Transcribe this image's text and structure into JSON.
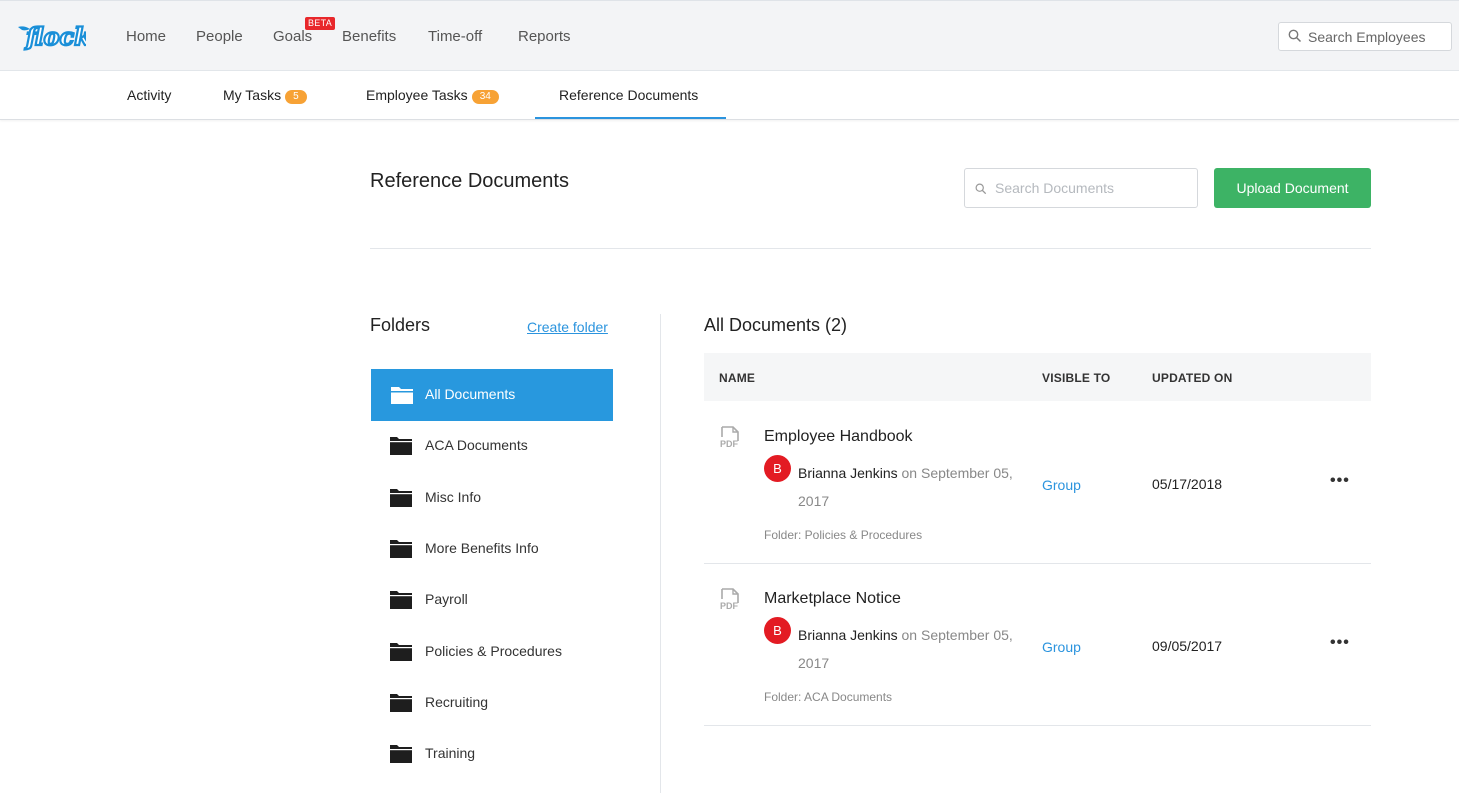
{
  "app": {
    "logo_text": "flock"
  },
  "nav": {
    "items": [
      {
        "label": "Home"
      },
      {
        "label": "People"
      },
      {
        "label": "Goals"
      },
      {
        "label": "Benefits"
      },
      {
        "label": "Time-off"
      },
      {
        "label": "Reports"
      }
    ],
    "goals_badge": "BETA",
    "search_placeholder": "Search Employees"
  },
  "tabs": [
    {
      "label": "Activity",
      "count": null
    },
    {
      "label": "My Tasks",
      "count": "5"
    },
    {
      "label": "Employee Tasks",
      "count": "34"
    },
    {
      "label": "Reference Documents",
      "count": null,
      "active": true
    }
  ],
  "page": {
    "title": "Reference Documents",
    "search_placeholder": "Search Documents",
    "upload_label": "Upload Document"
  },
  "folders": {
    "title": "Folders",
    "create_label": "Create folder",
    "items": [
      {
        "label": "All Documents",
        "active": true
      },
      {
        "label": "ACA Documents"
      },
      {
        "label": "Misc Info"
      },
      {
        "label": "More Benefits Info"
      },
      {
        "label": "Payroll"
      },
      {
        "label": "Policies & Procedures"
      },
      {
        "label": "Recruiting"
      },
      {
        "label": "Training"
      }
    ]
  },
  "documents": {
    "title": "All Documents (2)",
    "columns": {
      "name": "NAME",
      "visible_to": "VISIBLE TO",
      "updated_on": "UPDATED ON"
    },
    "rows": [
      {
        "file_type": "PDF",
        "name": "Employee Handbook",
        "avatar_initial": "B",
        "author": "Brianna Jenkins",
        "date_text": "on September 05, 2017",
        "folder": "Folder: Policies & Procedures",
        "visible_to": "Group",
        "updated_on": "05/17/2018",
        "actions": "•••"
      },
      {
        "file_type": "PDF",
        "name": "Marketplace Notice",
        "avatar_initial": "B",
        "author": "Brianna Jenkins",
        "date_text": "on September 05, 2017",
        "folder": "Folder: ACA Documents",
        "visible_to": "Group",
        "updated_on": "09/05/2017",
        "actions": "•••"
      }
    ]
  },
  "colors": {
    "accent_blue": "#2898de",
    "upload_green": "#3db365",
    "badge_orange": "#f7a235",
    "avatar_red": "#e31b23",
    "beta_red": "#e8272b"
  }
}
